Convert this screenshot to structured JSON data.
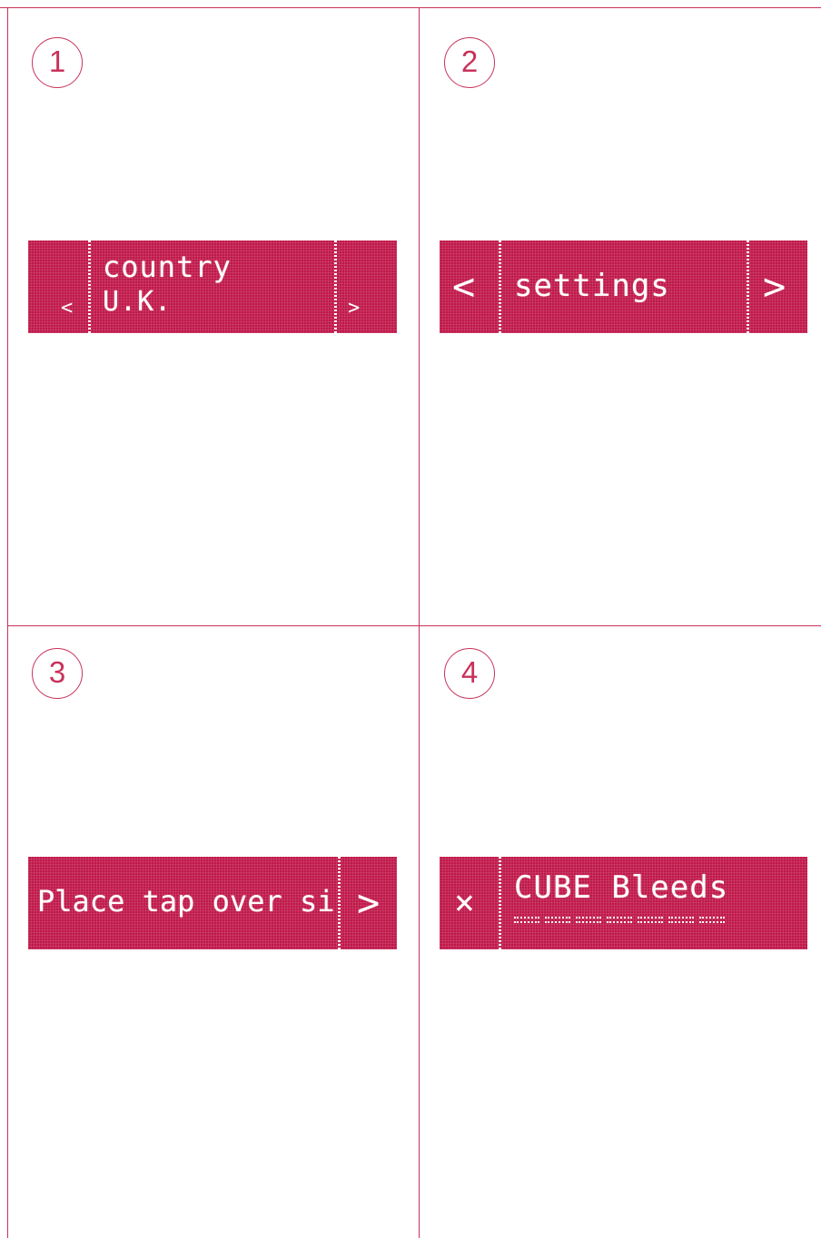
{
  "colors": {
    "accent": "#c8325a",
    "display": "#c0184a",
    "text": "#ffffff"
  },
  "panels": [
    {
      "step": "1",
      "left_icon": "chevron-left-icon",
      "right_icon": "chevron-right-icon",
      "label": "country",
      "value": "U.K."
    },
    {
      "step": "2",
      "left_icon": "chevron-left-icon",
      "right_icon": "chevron-right-icon",
      "label": "settings"
    },
    {
      "step": "3",
      "right_icon": "chevron-right-icon",
      "label": "Place tap over si"
    },
    {
      "step": "4",
      "left_icon": "close-icon",
      "label": "CUBE Bleeds",
      "progress_segments": 7
    }
  ]
}
